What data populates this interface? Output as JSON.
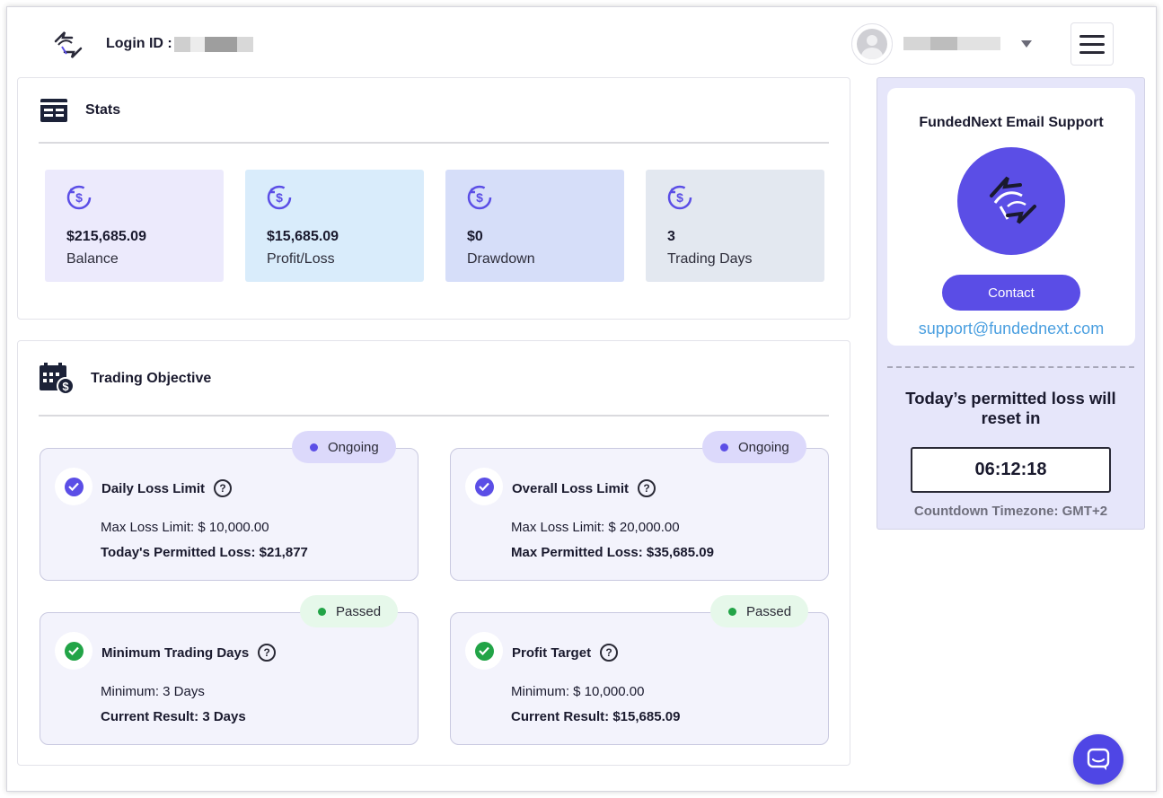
{
  "header": {
    "login_label": "Login ID :",
    "user_caret_icon": "caret-down-icon",
    "menu_icon": "hamburger-icon"
  },
  "stats": {
    "title": "Stats",
    "cards": [
      {
        "value": "$215,685.09",
        "label": "Balance",
        "color": "#eceafc",
        "icon": "dollar-refresh-icon"
      },
      {
        "value": "$15,685.09",
        "label": "Profit/Loss",
        "color": "#d9ecfb",
        "icon": "dollar-refresh-icon"
      },
      {
        "value": "$0",
        "label": "Drawdown",
        "color": "#d6def9",
        "icon": "dollar-refresh-icon"
      },
      {
        "value": "3",
        "label": "Trading Days",
        "color": "#e3e8f0",
        "icon": "dollar-refresh-icon"
      }
    ]
  },
  "objective": {
    "title": "Trading Objective",
    "cards": [
      {
        "title": "Daily Loss Limit",
        "status": "Ongoing",
        "line1": "Max Loss Limit: $ 10,000.00",
        "line2": "Today's Permitted Loss: $21,877"
      },
      {
        "title": "Overall Loss Limit",
        "status": "Ongoing",
        "line1": "Max Loss Limit: $ 20,000.00",
        "line2": "Max Permitted Loss: $35,685.09"
      },
      {
        "title": "Minimum Trading Days",
        "status": "Passed",
        "line1": "Minimum: 3 Days",
        "line2": "Current Result:  3 Days"
      },
      {
        "title": "Profit Target",
        "status": "Passed",
        "line1": "Minimum: $ 10,000.00",
        "line2": "Current Result:  $15,685.09"
      }
    ],
    "colors": {
      "ongoing_bg": "#dcd9fb",
      "ongoing_dot": "#5b4ee6",
      "passed_bg": "#e6f8ea",
      "passed_dot": "#22a447"
    }
  },
  "support": {
    "title": "FundedNext Email Support",
    "contact_label": "Contact",
    "email": "support@fundednext.com",
    "reset_text": "Today’s permitted loss will reset in",
    "timer": "06:12:18",
    "timezone": "Countdown Timezone: GMT+2"
  },
  "help_icon_glyph": "?",
  "chat_icon": "chat-bubble-icon"
}
